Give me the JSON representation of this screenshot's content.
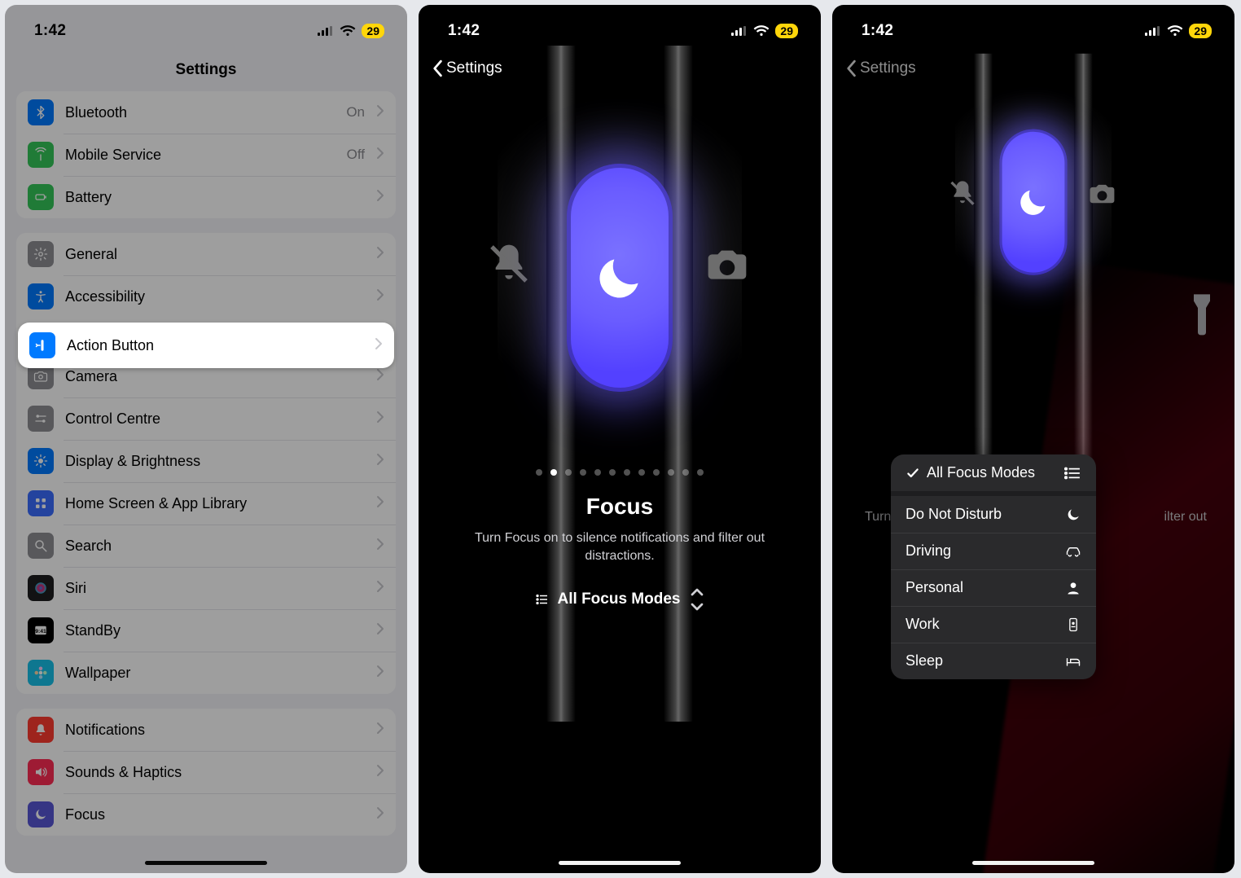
{
  "status": {
    "time": "1:42",
    "battery": "29"
  },
  "screen1": {
    "title": "Settings",
    "group1": [
      {
        "label": "Bluetooth",
        "value": "On",
        "iconBg": "#007aff",
        "icon": "bluetooth"
      },
      {
        "label": "Mobile Service",
        "value": "Off",
        "iconBg": "#34c759",
        "icon": "antenna"
      },
      {
        "label": "Battery",
        "value": "",
        "iconBg": "#34c759",
        "icon": "battery"
      }
    ],
    "highlighted": {
      "label": "Action Button",
      "iconBg": "#007aff",
      "icon": "action-button"
    },
    "group2": [
      {
        "label": "General",
        "iconBg": "#8e8e93",
        "icon": "gear"
      },
      {
        "label": "Accessibility",
        "iconBg": "#007aff",
        "icon": "accessibility"
      },
      {
        "label": "Action Button",
        "iconBg": "#007aff",
        "icon": "action-button",
        "hl_placeholder": true
      },
      {
        "label": "Camera",
        "iconBg": "#8e8e93",
        "icon": "camera"
      },
      {
        "label": "Control Centre",
        "iconBg": "#8e8e93",
        "icon": "switches"
      },
      {
        "label": "Display & Brightness",
        "iconBg": "#007aff",
        "icon": "brightness"
      },
      {
        "label": "Home Screen & App Library",
        "iconBg": "#3a6cff",
        "icon": "grid"
      },
      {
        "label": "Search",
        "iconBg": "#8e8e93",
        "icon": "search"
      },
      {
        "label": "Siri",
        "iconBg": "#1d1d1f",
        "icon": "siri"
      },
      {
        "label": "StandBy",
        "iconBg": "#000000",
        "icon": "clock"
      },
      {
        "label": "Wallpaper",
        "iconBg": "#17c1e8",
        "icon": "flower"
      }
    ],
    "group3": [
      {
        "label": "Notifications",
        "iconBg": "#ff3b30",
        "icon": "bell"
      },
      {
        "label": "Sounds & Haptics",
        "iconBg": "#ff2d55",
        "icon": "speaker"
      },
      {
        "label": "Focus",
        "iconBg": "#5856d6",
        "icon": "moon"
      }
    ]
  },
  "screen2": {
    "back": "Settings",
    "title": "Focus",
    "desc": "Turn Focus on to silence notifications and filter out distractions.",
    "selector": "All Focus Modes",
    "dot_count": 12,
    "dot_active_index": 1
  },
  "screen3": {
    "back": "Settings",
    "bg_hint_left": "Turn",
    "bg_hint_right": "ilter out",
    "popover": {
      "header": "All Focus Modes",
      "items": [
        {
          "label": "Do Not Disturb",
          "icon": "moon"
        },
        {
          "label": "Driving",
          "icon": "car"
        },
        {
          "label": "Personal",
          "icon": "person"
        },
        {
          "label": "Work",
          "icon": "badge"
        },
        {
          "label": "Sleep",
          "icon": "bed"
        }
      ]
    }
  }
}
